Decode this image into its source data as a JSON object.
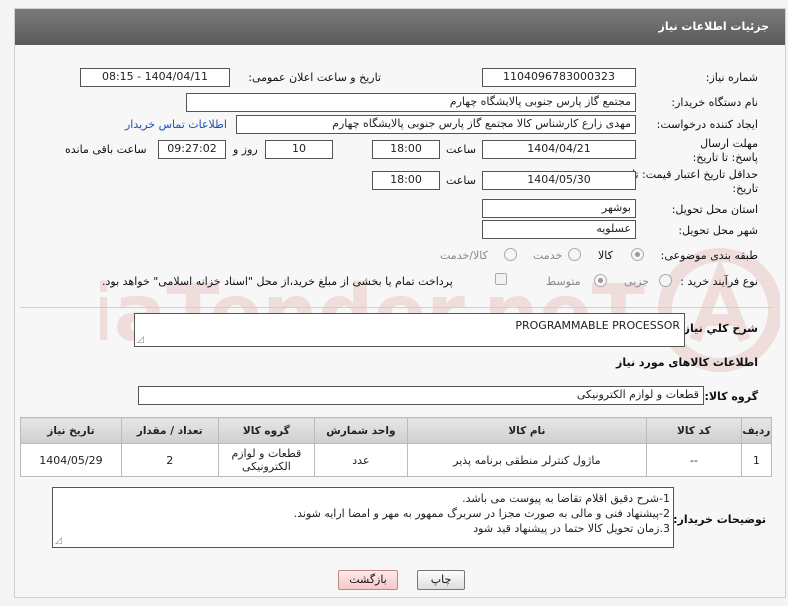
{
  "header": {
    "title": "جزئیات اطلاعات نیاز"
  },
  "fields": {
    "need_number_label": "شماره نیاز:",
    "need_number": "1104096783000323",
    "announce_label": "تاریخ و ساعت اعلان عمومی:",
    "announce_value": "1404/04/11 - 08:15",
    "buyer_org_label": "نام دستگاه خریدار:",
    "buyer_org": "مجتمع گاز پارس جنوبی  پالایشگاه چهارم",
    "creator_label": "ایجاد کننده درخواست:",
    "creator": "مهدی زارع کارشناس کالا مجتمع گاز پارس جنوبی  پالایشگاه چهارم",
    "buyer_contact_link": "اطلاعات تماس خریدار",
    "reply_deadline_label": "مهلت ارسال پاسخ: تا تاریخ:",
    "reply_date": "1404/04/21",
    "time_label": "ساعت",
    "reply_time": "18:00",
    "days_value": "10",
    "days_label": "روز و",
    "remaining_time": "09:27:02",
    "remaining_label": "ساعت باقی مانده",
    "price_validity_label": "حداقل تاریخ اعتبار قیمت: تا تاریخ:",
    "price_date": "1404/05/30",
    "price_time": "18:00",
    "province_label": "استان محل تحویل:",
    "province": "بوشهر",
    "city_label": "شهر محل تحویل:",
    "city": "عسلویه",
    "category_label": "طبقه بندی موضوعی:",
    "category_options": [
      "کالا",
      "خدمت",
      "کالا/خدمت"
    ],
    "process_label": "نوع فرآیند خرید :",
    "process_options": [
      "جزیی",
      "متوسط"
    ],
    "payment_note": "پرداخت تمام یا بخشی از مبلغ خرید،از محل \"اسناد خزانه اسلامی\" خواهد بود."
  },
  "description": {
    "label": "شرح کلي نياز:",
    "value": "PROGRAMMABLE PROCESSOR"
  },
  "goods_section": {
    "title": "اطلاعات کالاهای مورد نیاز",
    "group_label": "گروه کالا:",
    "group_value": "قطعات و لوازم الکترونیکی"
  },
  "table": {
    "headers": [
      "ردیف",
      "کد کالا",
      "نام کالا",
      "واحد شمارش",
      "گروه کالا",
      "تعداد / مقدار",
      "تاریخ نیاز"
    ],
    "rows": [
      [
        "1",
        "--",
        "ماژول کنترلر منطقی برنامه پذیر",
        "عدد",
        "قطعات و لوازم الکترونیکی",
        "2",
        "1404/05/29"
      ]
    ]
  },
  "buyer_notes": {
    "label": "توضیحات خریدار:",
    "lines": [
      "1-شرح دقیق اقلام تقاضا به پیوست می باشد.",
      "2-پیشنهاد فنی و مالی به صورت مجزا در سربرگ ممهور به مهر و امضا ارایه شوند.",
      "3.زمان تحویل کالا حتما در پیشنهاد قید شود"
    ]
  },
  "buttons": {
    "print": "چاپ",
    "back": "بازگشت"
  },
  "watermark": {
    "text": "AriaTender.neT"
  },
  "icons": {
    "watermark_logo": "aria-logo-icon"
  }
}
